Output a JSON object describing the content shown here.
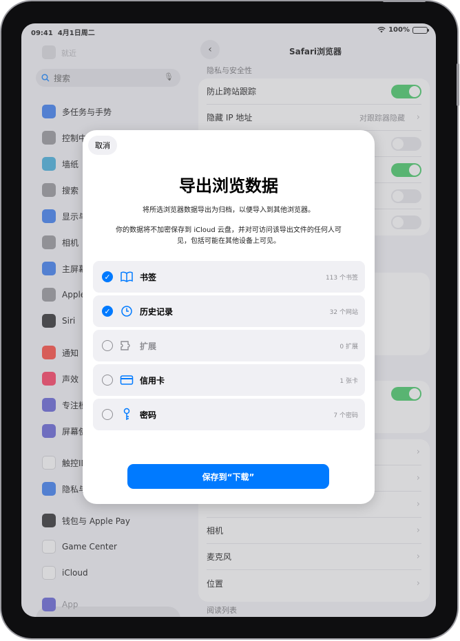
{
  "status_bar": {
    "time": "09:41",
    "date": "4月1日周二",
    "battery": "100%"
  },
  "sidebar": {
    "top_label": "就近",
    "search_placeholder": "搜索",
    "items": [
      {
        "label": "多任务与手势",
        "color": "#2b73f2",
        "icon": "multitasking-icon"
      },
      {
        "label": "控制中心",
        "color": "#8e8e93",
        "icon": "control-center-icon"
      },
      {
        "label": "墙纸",
        "color": "#34aadc",
        "icon": "wallpaper-icon"
      },
      {
        "label": "搜索",
        "color": "#8e8e93",
        "icon": "search-icon"
      },
      {
        "label": "显示与亮度",
        "color": "#2b73f2",
        "icon": "display-icon"
      },
      {
        "label": "相机",
        "color": "#8e8e93",
        "icon": "camera-icon"
      },
      {
        "label": "主屏幕",
        "color": "#2b73f2",
        "icon": "home-screen-icon"
      },
      {
        "label": "Apple Pencil",
        "color": "#8e8e93",
        "icon": "pencil-icon"
      },
      {
        "label": "Siri",
        "color": "#1c1c1e",
        "icon": "siri-icon"
      },
      {
        "label": "通知",
        "color": "#ff3b30",
        "icon": "notifications-icon"
      },
      {
        "label": "声效",
        "color": "#ff2d55",
        "icon": "sounds-icon"
      },
      {
        "label": "专注模式",
        "color": "#5856d6",
        "icon": "focus-icon"
      },
      {
        "label": "屏幕使用时间",
        "color": "#5856d6",
        "icon": "screen-time-icon"
      },
      {
        "label": "触控ID与密码",
        "color": "#ffffff",
        "icon": "touch-id-icon"
      },
      {
        "label": "隐私与安全性",
        "color": "#2b73f2",
        "icon": "privacy-icon"
      },
      {
        "label": "钱包与 Apple Pay",
        "color": "#1c1c1e",
        "icon": "wallet-icon"
      },
      {
        "label": "Game Center",
        "color": "#ffffff",
        "icon": "game-center-icon"
      },
      {
        "label": "iCloud",
        "color": "#ffffff",
        "icon": "icloud-icon"
      },
      {
        "label": "App",
        "color": "#5856d6",
        "icon": "apps-icon"
      }
    ]
  },
  "detail": {
    "title": "Safari浏览器",
    "section_privacy": "隐私与安全性",
    "rows": [
      {
        "label": "防止跨站跟踪",
        "type": "toggle",
        "on": true
      },
      {
        "label": "隐藏 IP 地址",
        "type": "value",
        "value": "对跟踪器隐藏"
      }
    ],
    "bottom_rows": [
      "相机",
      "麦克风",
      "位置"
    ],
    "section_reading": "阅读列表"
  },
  "modal": {
    "cancel": "取消",
    "title": "导出浏览数据",
    "desc1": "将所选浏览器数据导出为归档，以便导入到其他浏览器。",
    "desc2": "你的数据将不加密保存到 iCloud 云盘，并对可访问该导出文件的任何人可见，包括可能在其他设备上可见。",
    "options": [
      {
        "label": "书签",
        "count": "113 个书签",
        "checked": true,
        "disabled": false,
        "icon": "book-icon"
      },
      {
        "label": "历史记录",
        "count": "32 个网站",
        "checked": true,
        "disabled": false,
        "icon": "clock-icon"
      },
      {
        "label": "扩展",
        "count": "0 扩展",
        "checked": false,
        "disabled": true,
        "icon": "extension-icon"
      },
      {
        "label": "信用卡",
        "count": "1 张卡",
        "checked": false,
        "disabled": false,
        "icon": "credit-card-icon"
      },
      {
        "label": "密码",
        "count": "7 个密码",
        "checked": false,
        "disabled": false,
        "icon": "key-icon"
      }
    ],
    "save_button": "保存到“下载”"
  }
}
